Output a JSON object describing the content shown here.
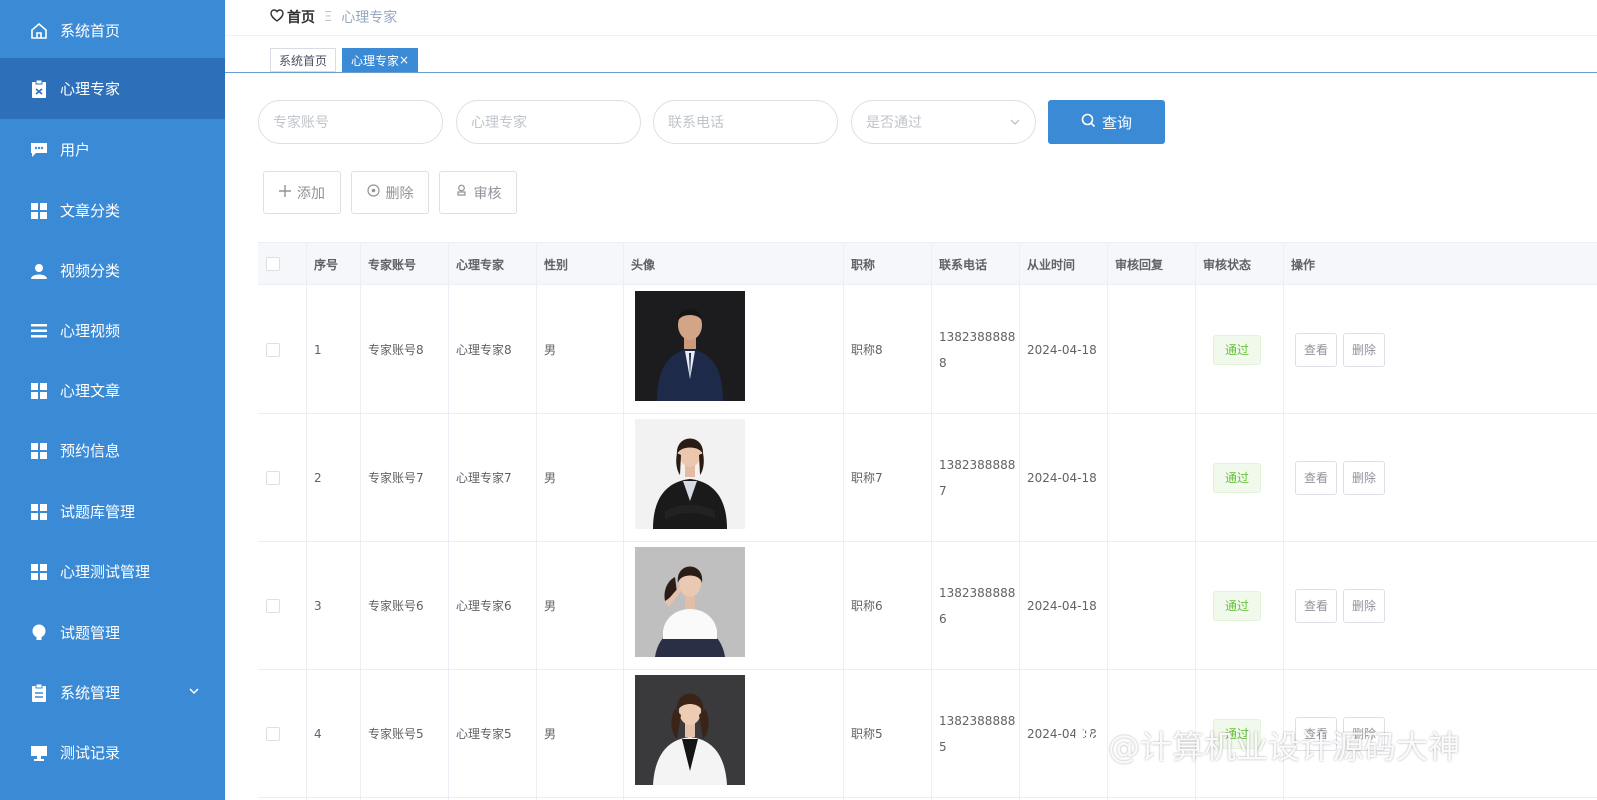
{
  "sidebar": {
    "items": [
      {
        "label": "系统首页",
        "icon": "home-icon"
      },
      {
        "label": "心理专家",
        "icon": "clipboard-icon",
        "active": true
      },
      {
        "label": "用户",
        "icon": "chat-icon"
      },
      {
        "label": "文章分类",
        "icon": "grid-icon"
      },
      {
        "label": "视频分类",
        "icon": "user-icon"
      },
      {
        "label": "心理视频",
        "icon": "list-icon"
      },
      {
        "label": "心理文章",
        "icon": "grid-icon"
      },
      {
        "label": "预约信息",
        "icon": "grid-icon"
      },
      {
        "label": "试题库管理",
        "icon": "grid-icon"
      },
      {
        "label": "心理测试管理",
        "icon": "grid-icon"
      },
      {
        "label": "试题管理",
        "icon": "bulb-icon"
      },
      {
        "label": "系统管理",
        "icon": "clipboard-icon"
      },
      {
        "label": "测试记录",
        "icon": "monitor-icon"
      }
    ]
  },
  "breadcrumb": {
    "home": "首页",
    "sep": "Ξ",
    "current": "心理专家"
  },
  "tabs": [
    {
      "label": "系统首页"
    },
    {
      "label": "心理专家",
      "close": "×"
    }
  ],
  "search": {
    "account_placeholder": "专家账号",
    "name_placeholder": "心理专家",
    "phone_placeholder": "联系电话",
    "status_placeholder": "是否通过",
    "query_label": "查询"
  },
  "actions": {
    "add": "添加",
    "delete": "删除",
    "review": "审核"
  },
  "table": {
    "headers": [
      "序号",
      "专家账号",
      "心理专家",
      "性别",
      "头像",
      "职称",
      "联系电话",
      "从业时间",
      "审核回复",
      "审核状态",
      "操作"
    ],
    "view_label": "查看",
    "delete_label": "删除",
    "rows": [
      {
        "no": "1",
        "account": "专家账号8",
        "name": "心理专家8",
        "gender": "男",
        "title": "职称8",
        "phone": "13823888888",
        "date": "2024-04-18",
        "reply": "",
        "status": "通过"
      },
      {
        "no": "2",
        "account": "专家账号7",
        "name": "心理专家7",
        "gender": "男",
        "title": "职称7",
        "phone": "13823888887",
        "date": "2024-04-18",
        "reply": "",
        "status": "通过"
      },
      {
        "no": "3",
        "account": "专家账号6",
        "name": "心理专家6",
        "gender": "男",
        "title": "职称6",
        "phone": "13823888886",
        "date": "2024-04-18",
        "reply": "",
        "status": "通过"
      },
      {
        "no": "4",
        "account": "专家账号5",
        "name": "心理专家5",
        "gender": "男",
        "title": "职称5",
        "phone": "13823888885",
        "date": "2024-04-18",
        "reply": "",
        "status": "通过"
      }
    ]
  },
  "watermark": "@计算机业设计源码大神"
}
